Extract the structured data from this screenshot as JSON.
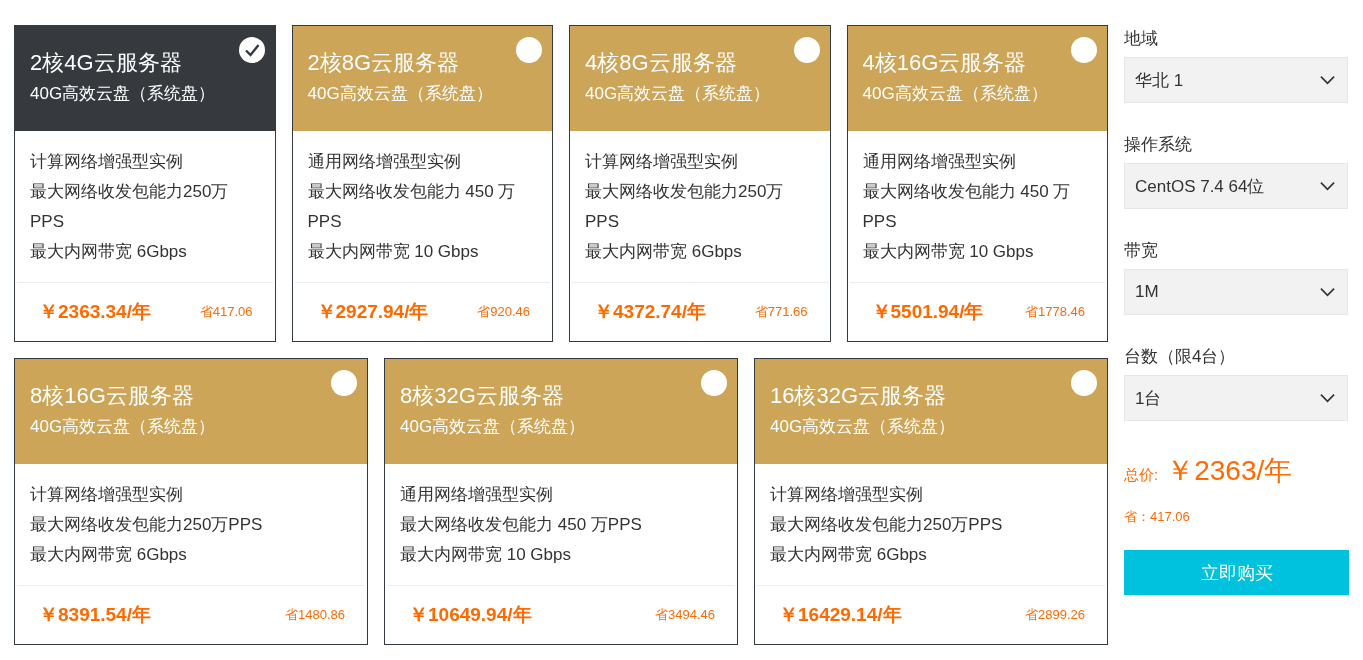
{
  "plans": [
    {
      "title": "2核4G云服务器",
      "disk": "40G高效云盘（系统盘）",
      "selected": true,
      "specs": [
        "计算网络增强型实例",
        "最大网络收发包能力250万PPS",
        "最大内网带宽 6Gbps"
      ],
      "price": "￥2363.34/年",
      "saving": "省417.06"
    },
    {
      "title": "2核8G云服务器",
      "disk": "40G高效云盘（系统盘）",
      "selected": false,
      "specs": [
        "通用网络增强型实例",
        "最大网络收发包能力 450 万 PPS",
        "最大内网带宽 10 Gbps"
      ],
      "price": "￥2927.94/年",
      "saving": "省920.46"
    },
    {
      "title": "4核8G云服务器",
      "disk": "40G高效云盘（系统盘）",
      "selected": false,
      "specs": [
        "计算网络增强型实例",
        "最大网络收发包能力250万PPS",
        "最大内网带宽 6Gbps"
      ],
      "price": "￥4372.74/年",
      "saving": "省771.66"
    },
    {
      "title": "4核16G云服务器",
      "disk": "40G高效云盘（系统盘）",
      "selected": false,
      "specs": [
        "通用网络增强型实例",
        "最大网络收发包能力 450 万 PPS",
        "最大内网带宽 10 Gbps"
      ],
      "price": "￥5501.94/年",
      "saving": "省1778.46"
    },
    {
      "title": "8核16G云服务器",
      "disk": "40G高效云盘（系统盘）",
      "selected": false,
      "specs": [
        "计算网络增强型实例",
        "最大网络收发包能力250万PPS",
        "最大内网带宽 6Gbps"
      ],
      "price": "￥8391.54/年",
      "saving": "省1480.86"
    },
    {
      "title": "8核32G云服务器",
      "disk": "40G高效云盘（系统盘）",
      "selected": false,
      "specs": [
        "通用网络增强型实例",
        "最大网络收发包能力 450 万PPS",
        "最大内网带宽 10 Gbps"
      ],
      "price": "￥10649.94/年",
      "saving": "省3494.46"
    },
    {
      "title": "16核32G云服务器",
      "disk": "40G高效云盘（系统盘）",
      "selected": false,
      "specs": [
        "计算网络增强型实例",
        "最大网络收发包能力250万PPS",
        "最大内网带宽 6Gbps"
      ],
      "price": "￥16429.14/年",
      "saving": "省2899.26"
    }
  ],
  "options": [
    {
      "label": "地域",
      "value": "华北 1"
    },
    {
      "label": "操作系统",
      "value": "CentOS 7.4 64位"
    },
    {
      "label": "带宽",
      "value": "1M"
    },
    {
      "label": "台数（限4台）",
      "value": "1台"
    }
  ],
  "total": {
    "label": "总价:",
    "price": "￥2363/年",
    "saving": "省：417.06"
  },
  "buy_button": "立即购买"
}
